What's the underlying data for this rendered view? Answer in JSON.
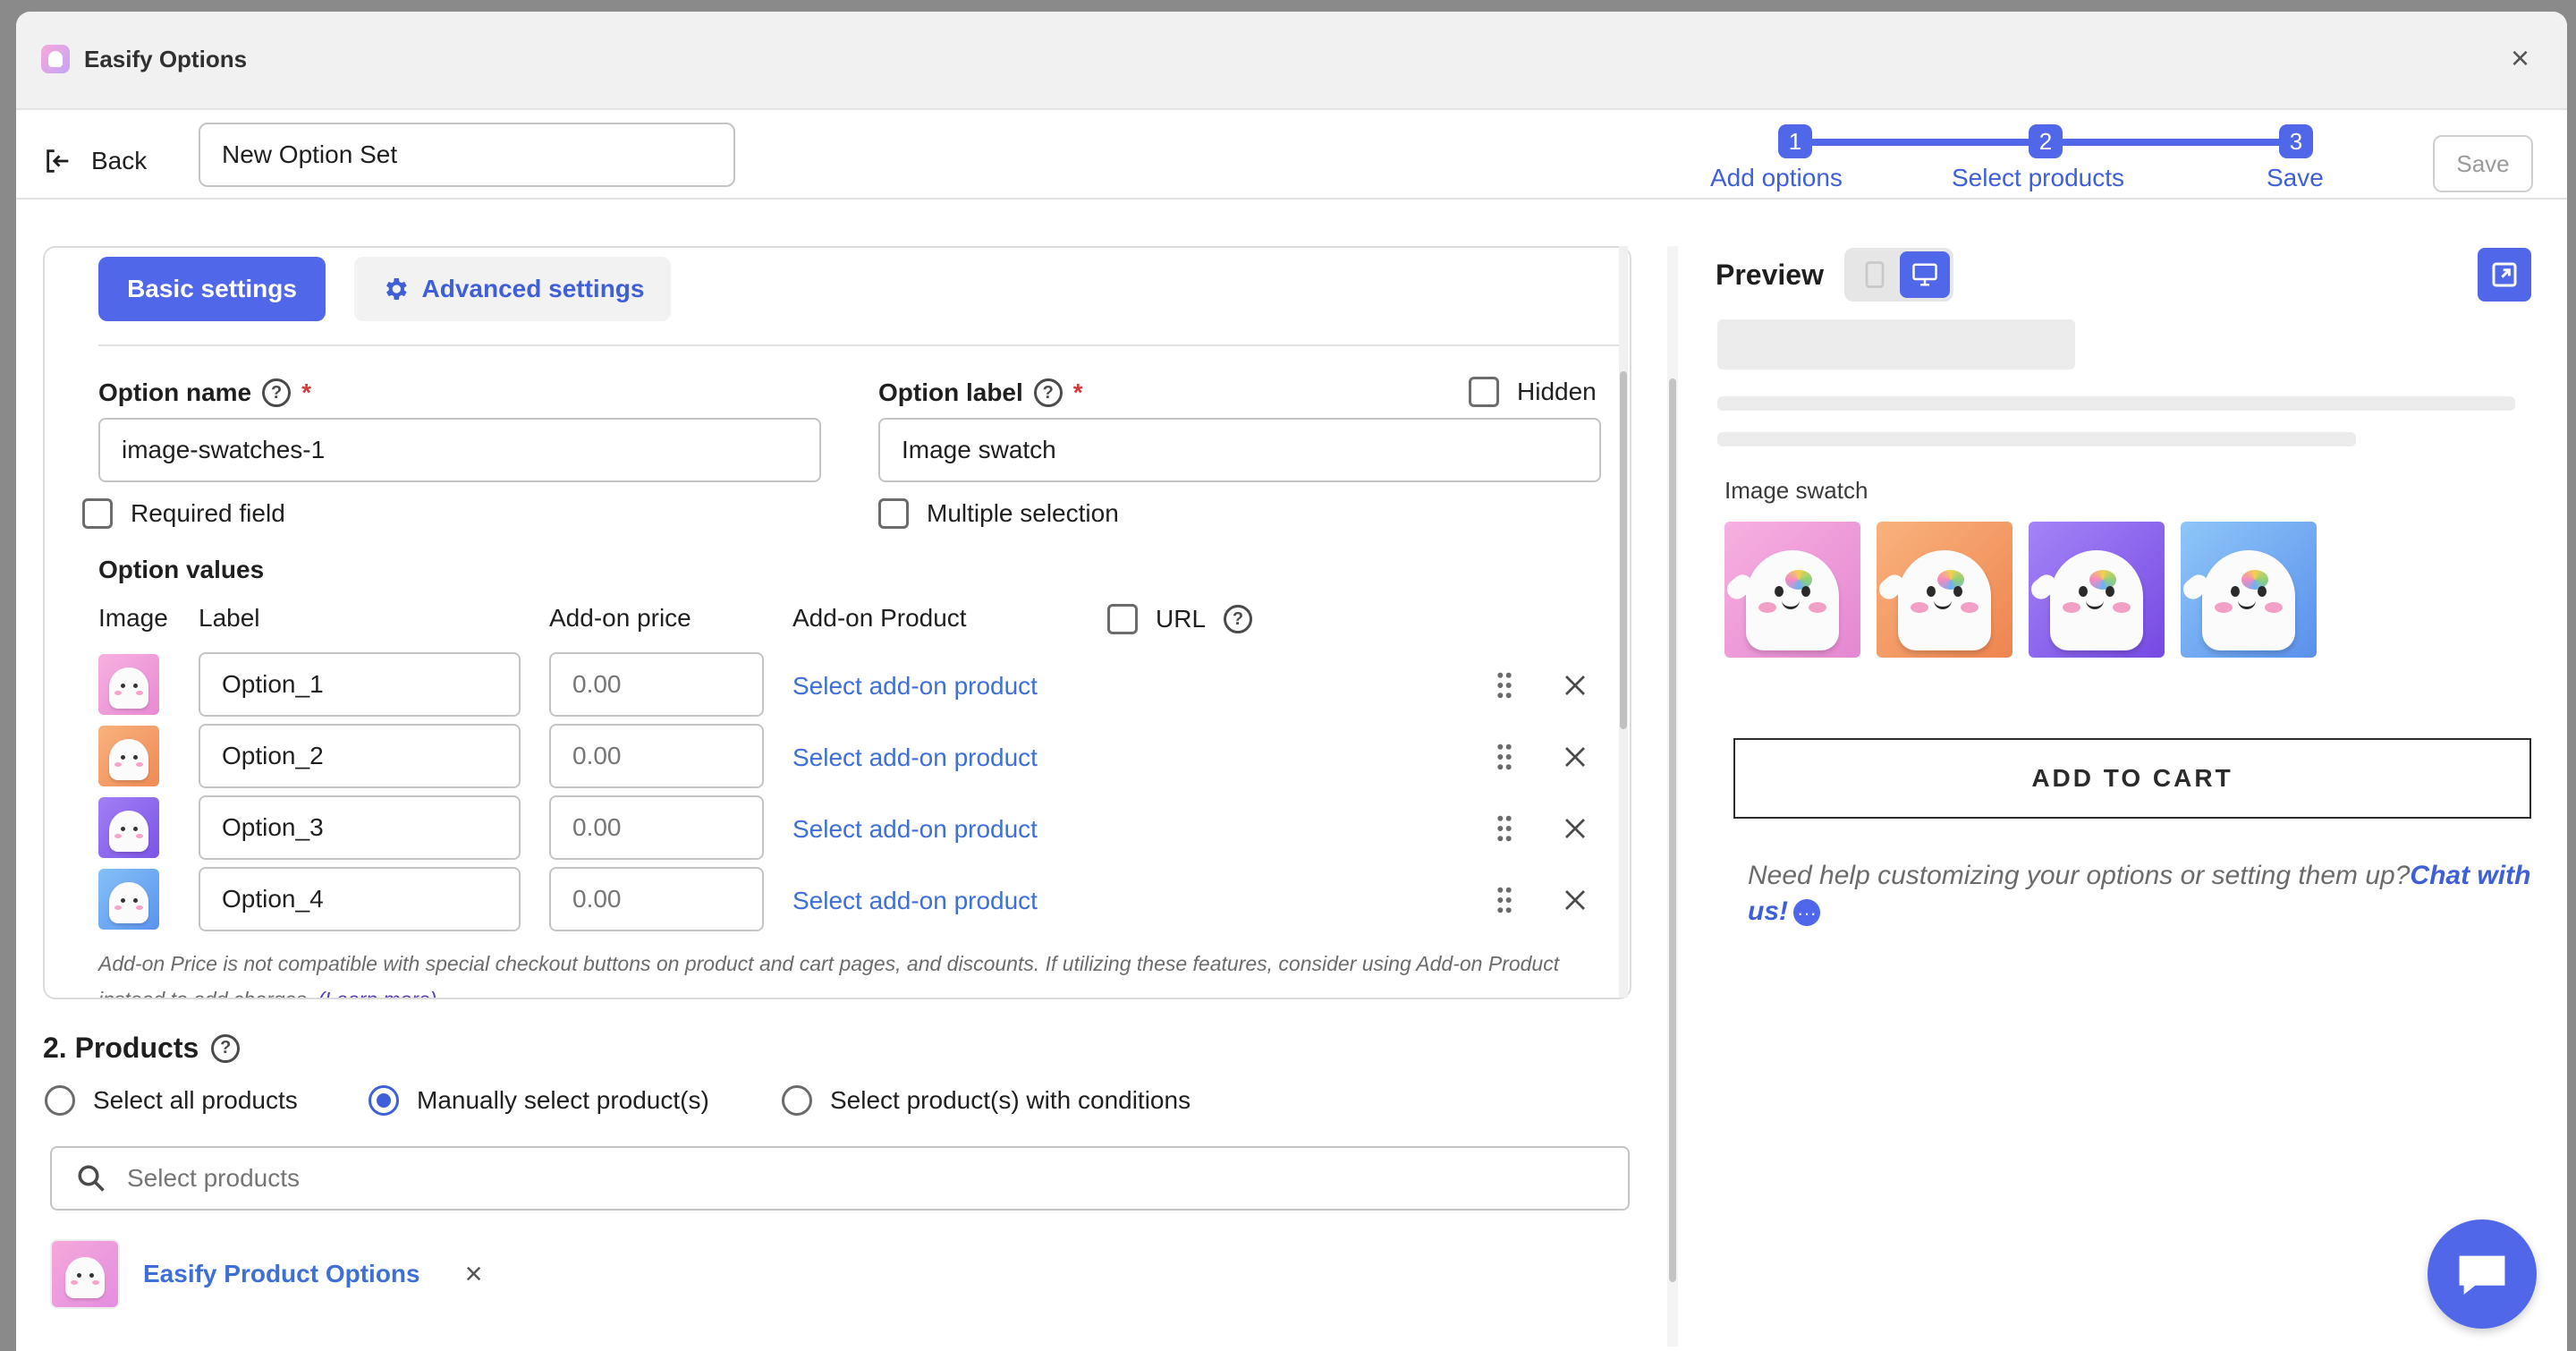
{
  "window": {
    "title": "Easify Options",
    "close_glyph": "×"
  },
  "toolbar": {
    "back_label": "Back",
    "option_set_name": "New Option Set",
    "save_label": "Save",
    "steps": [
      {
        "number": "1",
        "label": "Add options"
      },
      {
        "number": "2",
        "label": "Select products"
      },
      {
        "number": "3",
        "label": "Save"
      }
    ]
  },
  "tabs": {
    "basic": "Basic settings",
    "advanced": "Advanced settings"
  },
  "option": {
    "name_label": "Option name",
    "name_value": "image-swatches-1",
    "label_label": "Option label",
    "label_value": "Image swatch",
    "required_asterisk": "*",
    "hidden_label": "Hidden",
    "required_field_label": "Required field",
    "multiple_selection_label": "Multiple selection",
    "values_heading": "Option values",
    "columns": {
      "image": "Image",
      "label": "Label",
      "price": "Add-on price",
      "product": "Add-on Product",
      "url": "URL"
    },
    "rows": [
      {
        "label": "Option_1",
        "price_placeholder": "0.00",
        "product_link": "Select add-on product",
        "color": "pink"
      },
      {
        "label": "Option_2",
        "price_placeholder": "0.00",
        "product_link": "Select add-on product",
        "color": "orange"
      },
      {
        "label": "Option_3",
        "price_placeholder": "0.00",
        "product_link": "Select add-on product",
        "color": "purple"
      },
      {
        "label": "Option_4",
        "price_placeholder": "0.00",
        "product_link": "Select add-on product",
        "color": "blue"
      }
    ],
    "note": "Add-on Price is not compatible with special checkout buttons on product and cart pages, and discounts. If utilizing these features, consider using Add-on Product instead to add charges.",
    "learn_more": "(Learn more)"
  },
  "products": {
    "title": "2. Products",
    "radio_all": "Select all products",
    "radio_manual": "Manually select product(s)",
    "radio_conditions": "Select product(s) with conditions",
    "selected_radio": "manual",
    "search_placeholder": "Select products",
    "selected_items": [
      {
        "name": "Easify Product Options"
      }
    ]
  },
  "preview": {
    "title": "Preview",
    "swatch_label": "Image swatch",
    "add_to_cart": "ADD TO CART",
    "help_text": "Need help customizing your options or setting them up?",
    "chat_link": "Chat with us!"
  },
  "colors": {
    "accent": "#4f67e8",
    "link": "#3e6fd6",
    "required": "#d23a3a",
    "swatch_pink": "#f29ad6",
    "swatch_orange": "#f4a06c",
    "swatch_purple": "#8f6ef0",
    "swatch_blue": "#6aa8f5"
  }
}
